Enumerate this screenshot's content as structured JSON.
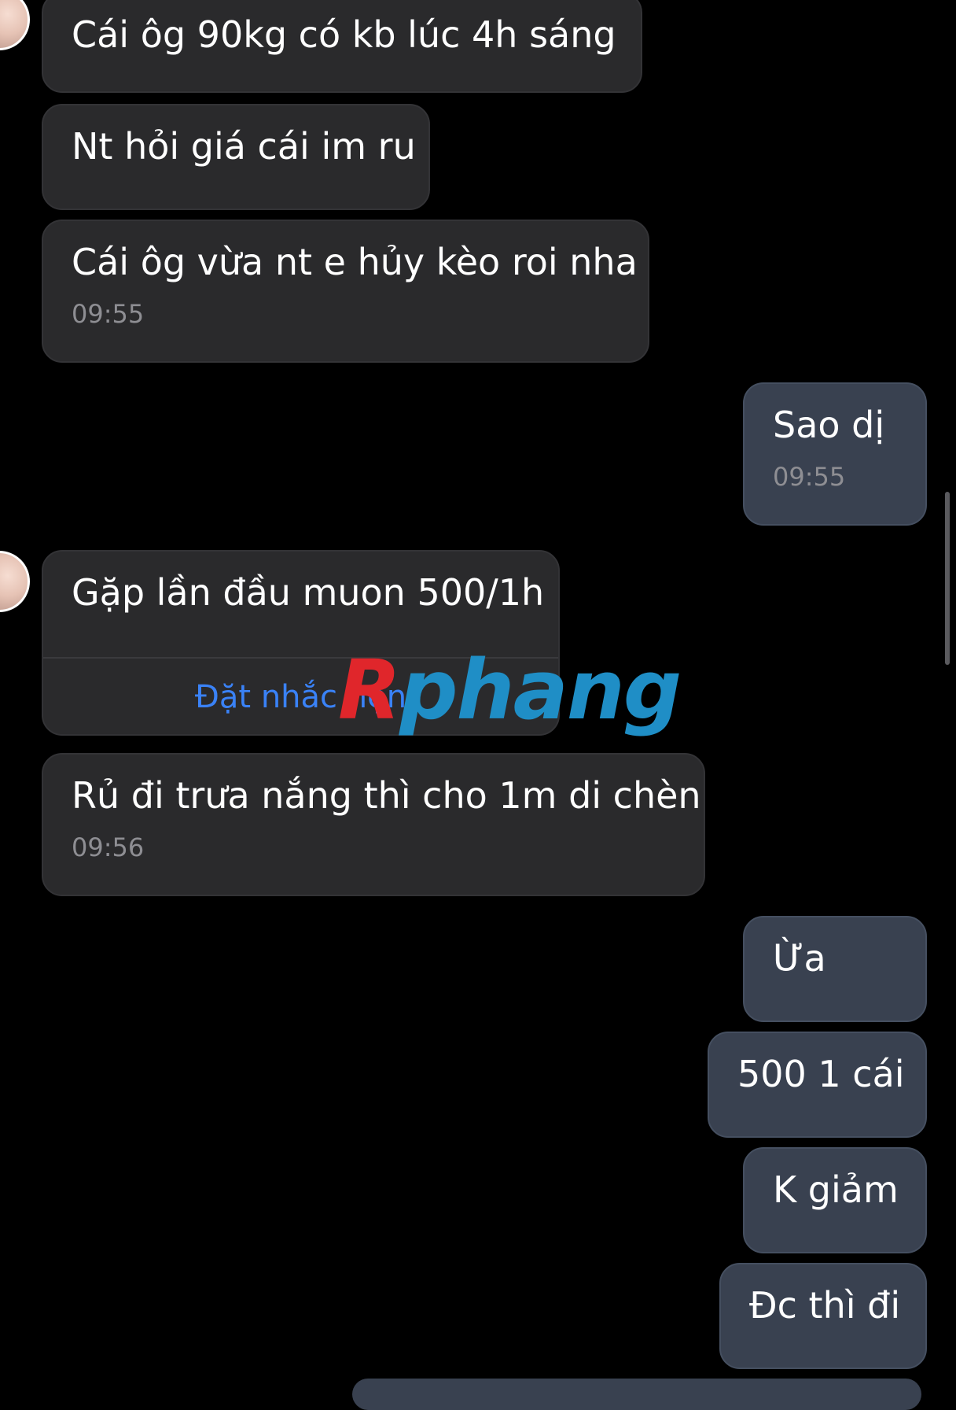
{
  "colors": {
    "background": "#000000",
    "incoming_bubble": "#2a2a2c",
    "outgoing_bubble": "#394150",
    "timestamp": "#8e8e93",
    "link": "#3a82f7"
  },
  "messages": [
    {
      "side": "incoming",
      "text": "Cái ôg 90kg có kb lúc 4h sáng"
    },
    {
      "side": "incoming",
      "text": "Nt hỏi giá cái im ru"
    },
    {
      "side": "incoming",
      "text": "Cái ôg vừa nt e hủy kèo roi nha",
      "time": "09:55"
    },
    {
      "side": "outgoing",
      "text": "Sao dị",
      "time": "09:55"
    },
    {
      "side": "incoming",
      "text": "Gặp lần đầu muon 500/1h",
      "action": "Đặt nhắc hẹn"
    },
    {
      "side": "incoming",
      "text": "Rủ đi trưa nắng thì cho 1m di chèn",
      "time": "09:56"
    },
    {
      "side": "outgoing",
      "text": "Ừa"
    },
    {
      "side": "outgoing",
      "text": "500 1 cái"
    },
    {
      "side": "outgoing",
      "text": "K giảm"
    },
    {
      "side": "outgoing",
      "text": "Đc thì đi"
    }
  ],
  "watermark": {
    "first": "R",
    "rest": "phang"
  }
}
